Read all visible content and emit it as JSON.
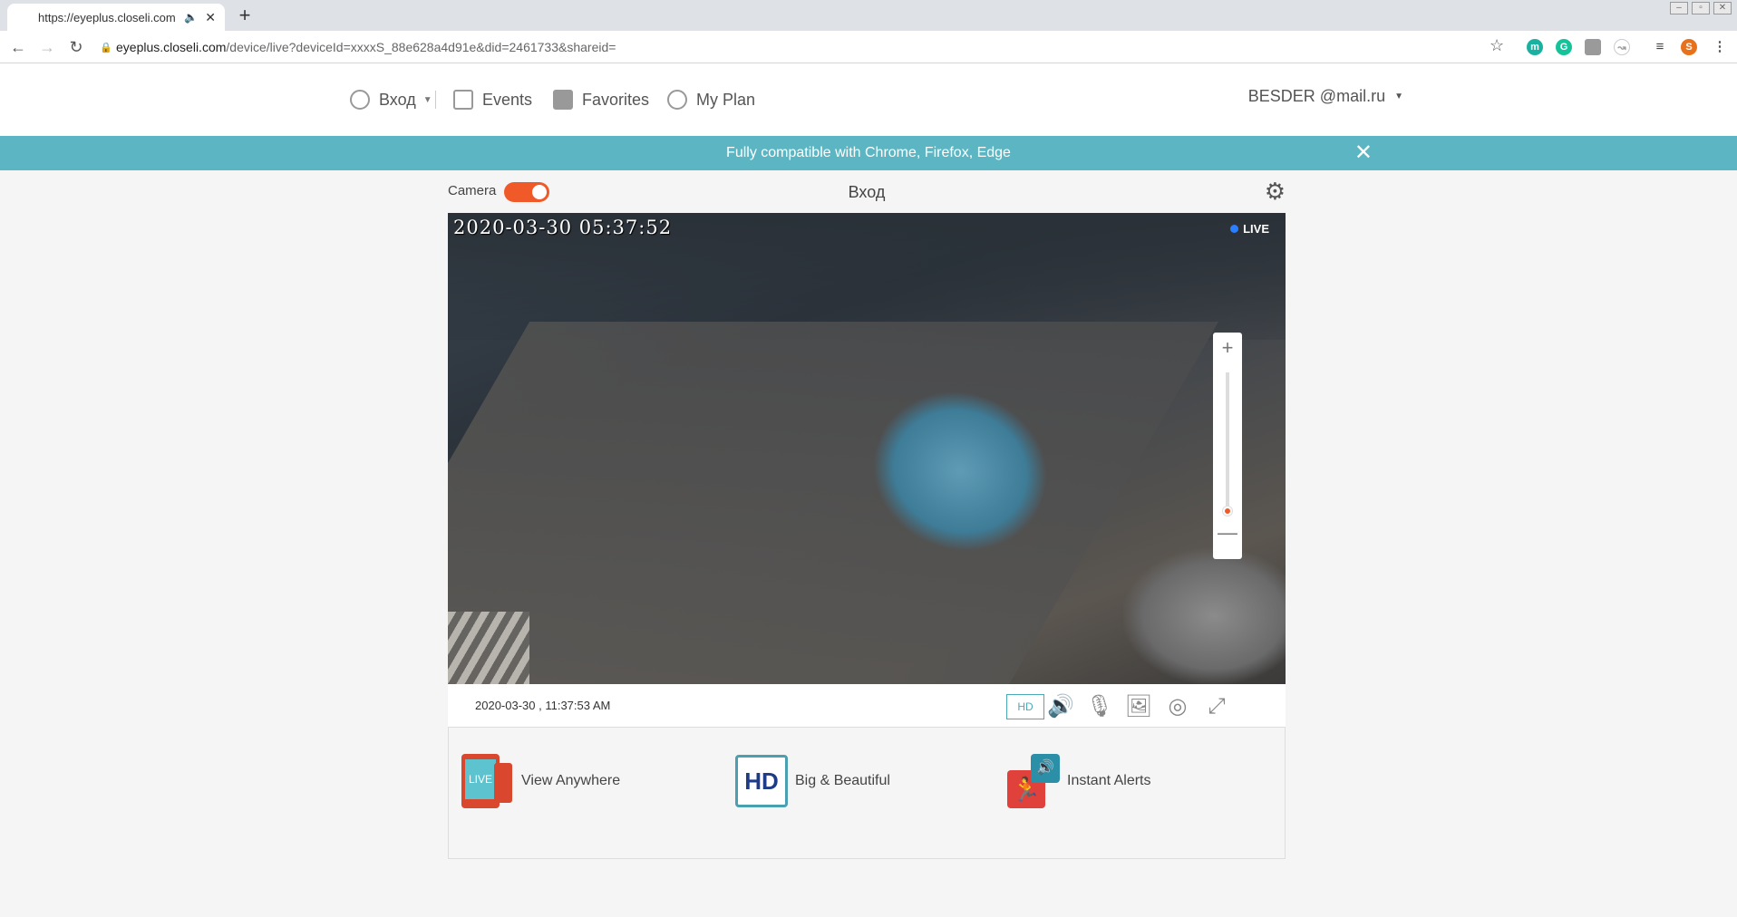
{
  "browser": {
    "tab_title": "https://eyeplus.closeli.com",
    "tab_audio_icon": "speaker-icon",
    "url_host": "eyeplus.closeli.com",
    "url_path": "/device/live?deviceId=xxxxS_88e628a4d91e&did=2461733&shareid=",
    "profile_initial": "S",
    "extensions": [
      {
        "name": "m-extension-icon",
        "glyph": "m",
        "color": "#1bb1a0"
      },
      {
        "name": "grammarly-icon",
        "glyph": "G",
        "color": "#15c39a"
      },
      {
        "name": "extension-icon",
        "glyph": "",
        "color": "#9a9a9a"
      },
      {
        "name": "extension-icon-2",
        "glyph": "",
        "color": "#bdbdbd"
      }
    ]
  },
  "nav": {
    "home_label": "Вход",
    "events_label": "Events",
    "favorites_label": "Favorites",
    "plan_label": "My Plan",
    "user_label": "BESDER @mail.ru"
  },
  "banner": {
    "text": "Fully compatible with Chrome, Firefox, Edge"
  },
  "camera": {
    "toggle_label": "Camera",
    "toggle_on": true,
    "name": "Вход",
    "osd_timestamp": "2020-03-30 05:37:52",
    "live_label": "LIVE",
    "current_time": "2020-03-30 , 11:37:53 AM",
    "hd_label": "HD",
    "zoom_level": 0
  },
  "features": [
    {
      "label": "View Anywhere",
      "icon": "live-devices-icon",
      "badge": "LIVE"
    },
    {
      "label": "Big & Beautiful",
      "icon": "hd-icon",
      "badge": "HD"
    },
    {
      "label": "Instant Alerts",
      "icon": "alert-icon",
      "badge": ""
    }
  ],
  "colors": {
    "accent": "#f05a28",
    "banner": "#5bb5c2",
    "hd": "#4aaab8"
  }
}
